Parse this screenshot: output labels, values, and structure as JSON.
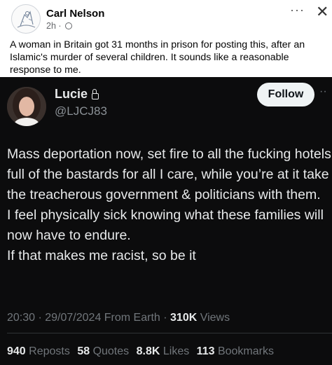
{
  "post": {
    "author": "Carl Nelson",
    "time": "2h",
    "more_icon": "more-horizontal-icon",
    "close_icon": "close-icon",
    "privacy_icon": "globe-icon",
    "caption": "A woman in Britain got 31 months in prison for posting this, after an Islamic's murder of several children. It sounds like a reasonable response to me."
  },
  "tweet": {
    "name": "Lucie",
    "handle": "@LJCJ83",
    "follow_label": "Follow",
    "body": "Mass deportation now, set fire to all the fucking hotels full of the bastards for all I care, while you’re at it take the treacherous government & politicians with them.\nI feel physically sick knowing what these families will now have to endure.\nIf that makes me racist, so be it",
    "timestamp": "20:30 · 29/07/2024 From Earth · ",
    "views_count": "310K",
    "views_label": " Views",
    "stats": {
      "reposts_count": "940",
      "reposts_label": "Reposts",
      "quotes_count": "58",
      "quotes_label": "Quotes",
      "likes_count": "8.8K",
      "likes_label": "Likes",
      "bookmarks_count": "113",
      "bookmarks_label": "Bookmarks"
    }
  }
}
